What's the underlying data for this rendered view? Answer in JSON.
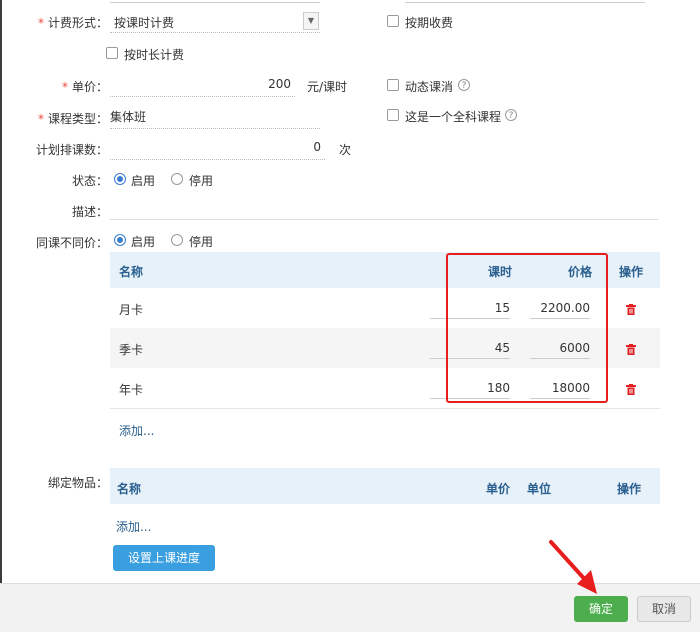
{
  "form": {
    "billing_label": "计费形式：",
    "billing_value": "按课时计费",
    "period_billing": "按期收费",
    "by_duration": "按时长计费",
    "price_label": "单价：",
    "price_value": "200",
    "price_unit": "元/课时",
    "dynamic_cancel": "动态课消",
    "course_type_label": "课程类型：",
    "course_type_value": "集体班",
    "full_course": "这是一个全科课程",
    "planned_label": "计划排课数：",
    "planned_value": "0",
    "planned_unit": "次",
    "status_label": "状态：",
    "status_on": "启用",
    "status_off": "停用",
    "desc_label": "描述：",
    "diffprice_label": "同课不同价：",
    "diffprice_on": "启用",
    "diffprice_off": "停用"
  },
  "price_table": {
    "col_name": "名称",
    "col_hours": "课时",
    "col_price": "价格",
    "col_action": "操作",
    "rows": [
      {
        "name": "月卡",
        "hours": "15",
        "price": "2200.00"
      },
      {
        "name": "季卡",
        "hours": "45",
        "price": "6000"
      },
      {
        "name": "年卡",
        "hours": "180",
        "price": "18000"
      }
    ],
    "add": "添加..."
  },
  "items_table": {
    "label": "绑定物品：",
    "col_name": "名称",
    "col_unit_price": "单价",
    "col_unit": "单位",
    "col_action": "操作",
    "add": "添加..."
  },
  "progress_button": "设置上课进度",
  "footer": {
    "ok": "确定",
    "cancel": "取消"
  },
  "colors": {
    "accent": "#3a9fe0",
    "ok": "#4cae4c",
    "highlight": "#e81e1e"
  }
}
